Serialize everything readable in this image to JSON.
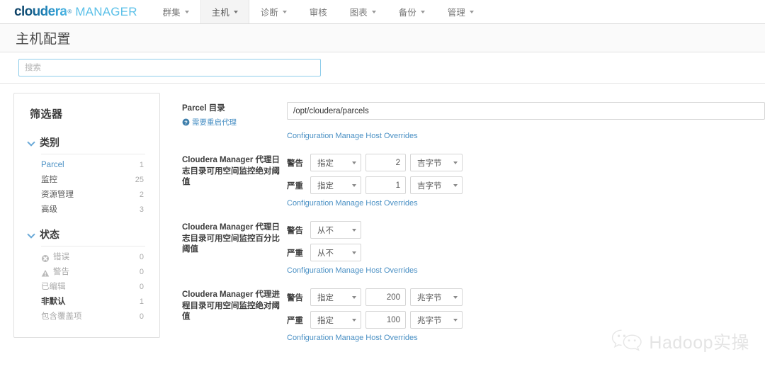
{
  "brand": {
    "name": "cloudera",
    "registered": "®",
    "product": "MANAGER"
  },
  "nav": {
    "items": [
      {
        "label": "群集",
        "has_caret": true,
        "active": false
      },
      {
        "label": "主机",
        "has_caret": true,
        "active": true
      },
      {
        "label": "诊断",
        "has_caret": true,
        "active": false
      },
      {
        "label": "审核",
        "has_caret": false,
        "active": false
      },
      {
        "label": "图表",
        "has_caret": true,
        "active": false
      },
      {
        "label": "备份",
        "has_caret": true,
        "active": false
      },
      {
        "label": "管理",
        "has_caret": true,
        "active": false
      }
    ]
  },
  "page": {
    "title": "主机配置"
  },
  "search": {
    "value": "",
    "placeholder": "搜索"
  },
  "filters": {
    "title": "筛选器",
    "groups": [
      {
        "label": "类别",
        "expanded": true,
        "items": [
          {
            "label": "Parcel",
            "count": "1",
            "style": "link",
            "icon": "none"
          },
          {
            "label": "监控",
            "count": "25",
            "style": "normal",
            "icon": "none"
          },
          {
            "label": "资源管理",
            "count": "2",
            "style": "normal",
            "icon": "none"
          },
          {
            "label": "高级",
            "count": "3",
            "style": "normal",
            "icon": "none"
          }
        ]
      },
      {
        "label": "状态",
        "expanded": true,
        "items": [
          {
            "label": "错误",
            "count": "0",
            "style": "muted",
            "icon": "error-circle-icon"
          },
          {
            "label": "警告",
            "count": "0",
            "style": "muted",
            "icon": "warning-triangle-icon"
          },
          {
            "label": "已编辑",
            "count": "0",
            "style": "muted",
            "icon": "none"
          },
          {
            "label": "非默认",
            "count": "1",
            "style": "strong",
            "icon": "none"
          },
          {
            "label": "包含覆盖项",
            "count": "0",
            "style": "muted",
            "icon": "none"
          }
        ]
      }
    ]
  },
  "config": {
    "override_link_label": "Configuration Manage Host Overrides",
    "rows": [
      {
        "type": "text",
        "label": "Parcel 目录",
        "hint": "需要重启代理",
        "hint_icon": "help-circle-icon",
        "value": "/opt/cloudera/parcels",
        "override_label": "Configuration Manage Host Overrides"
      },
      {
        "type": "threshold",
        "label": "Cloudera Manager 代理日志目录可用空间监控绝对阈值",
        "hint": "",
        "lines": [
          {
            "severity": "警告",
            "mode": "指定",
            "number": "2",
            "unit": "吉字节",
            "has_number": true
          },
          {
            "severity": "严重",
            "mode": "指定",
            "number": "1",
            "unit": "吉字节",
            "has_number": true
          }
        ],
        "override_label": "Configuration Manage Host Overrides"
      },
      {
        "type": "threshold",
        "label": "Cloudera Manager 代理日志目录可用空间监控百分比阈值",
        "hint": "",
        "lines": [
          {
            "severity": "警告",
            "mode": "从不",
            "number": "",
            "unit": "",
            "has_number": false
          },
          {
            "severity": "严重",
            "mode": "从不",
            "number": "",
            "unit": "",
            "has_number": false
          }
        ],
        "override_label": "Configuration Manage Host Overrides"
      },
      {
        "type": "threshold",
        "label": "Cloudera Manager 代理进程目录可用空间监控绝对阈值",
        "hint": "",
        "lines": [
          {
            "severity": "警告",
            "mode": "指定",
            "number": "200",
            "unit": "兆字节",
            "has_number": true
          },
          {
            "severity": "严重",
            "mode": "指定",
            "number": "100",
            "unit": "兆字节",
            "has_number": true
          }
        ],
        "override_label": "Configuration Manage Host Overrides"
      }
    ]
  },
  "watermark": {
    "icon": "wechat-icon",
    "text": "Hadoop实操"
  },
  "colors": {
    "brand_dark": "#0b3d61",
    "brand_light": "#5bc0e8",
    "link": "#4a90c4",
    "focus_border": "#8ecdea",
    "text": "#3d3d3d",
    "muted": "#a9a9a9"
  }
}
